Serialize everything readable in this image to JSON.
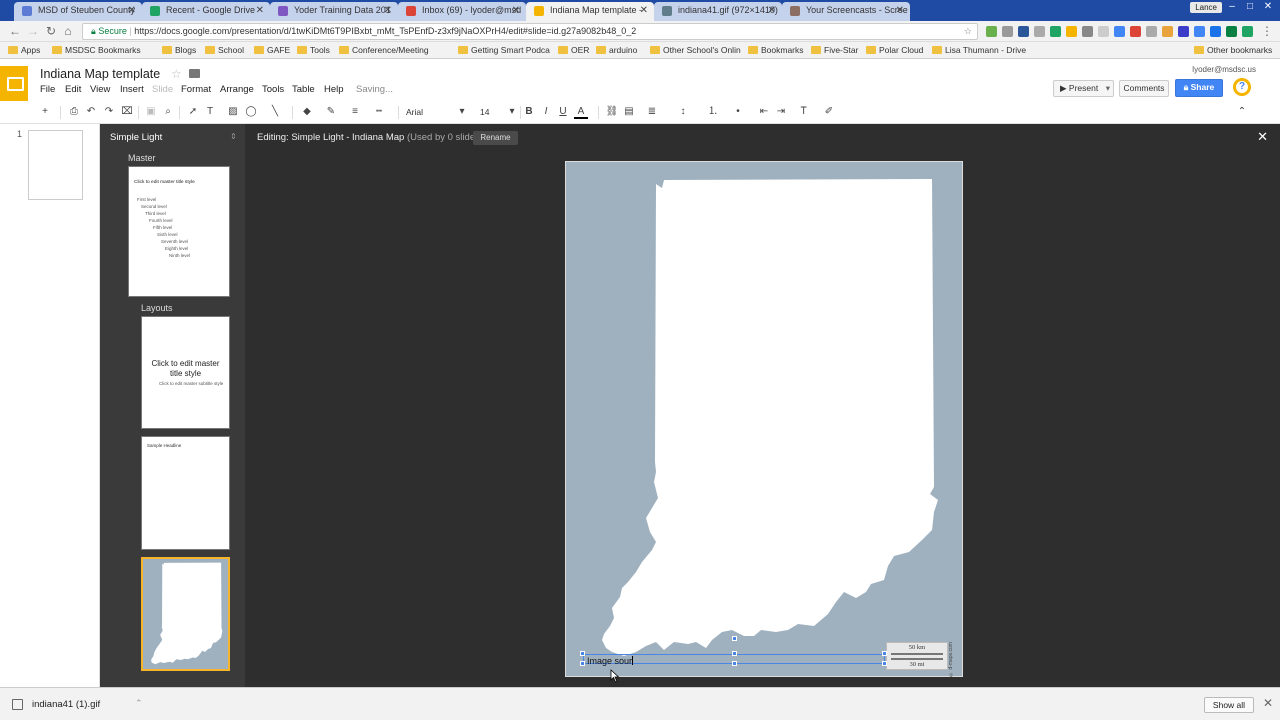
{
  "browser": {
    "tabs": [
      {
        "label": "MSD of Steuben County",
        "color": "#5b7bd5"
      },
      {
        "label": "Recent - Google Drive",
        "color": "#1fa463"
      },
      {
        "label": "Yoder Training Data 201",
        "color": "#7e57c2"
      },
      {
        "label": "Inbox (69) - lyoder@msd",
        "color": "#db4437"
      },
      {
        "label": "Indiana Map template -",
        "color": "#f4b400"
      },
      {
        "label": "indiana41.gif (972×1410)",
        "color": "#607d8b"
      },
      {
        "label": "Your Screencasts - Scree",
        "color": "#8d6e63"
      }
    ],
    "window_user": "Lance",
    "secure_label": "Secure",
    "url": "https://docs.google.com/presentation/d/1twKiDMt6T9PIBxbt_mMt_TsPEnfD-z3xf9jNaOXPrH4/edit#slide=id.g27a9082b48_0_2",
    "bookmarks": [
      "Apps",
      "MSDSC Bookmarks",
      "Blogs",
      "School",
      "GAFE",
      "Tools",
      "Conference/Meeting",
      "Getting Smart Podca",
      "arduino",
      "OER",
      "Other School's Onlin",
      "Bookmarks",
      "Five-Star",
      "Polar Cloud",
      "Lisa Thumann - Drive",
      "Other bookmarks"
    ]
  },
  "docs": {
    "title": "Indiana Map template",
    "menus": [
      "File",
      "Edit",
      "View",
      "Insert",
      "Slide",
      "Format",
      "Arrange",
      "Tools",
      "Table",
      "Help"
    ],
    "saving_status": "Saving...",
    "user_email": "lyoder@msdsc.us",
    "present_label": "Present",
    "comments_label": "Comments",
    "share_label": "Share",
    "help_glyph": "?",
    "font_name": "Arial",
    "font_size": "14"
  },
  "editor": {
    "slide_number": "1",
    "theme_name": "Simple Light",
    "master_label": "Master",
    "layouts_label": "Layouts",
    "master_thumb_title": "Click to edit master title style",
    "master_thumb_bullets": [
      "First level",
      "Second level",
      "Third level",
      "Fourth level",
      "Fifth level",
      "Sixth level",
      "Seventh level",
      "Eighth level",
      "Ninth level"
    ],
    "layout1_title": "Click to edit master title style",
    "layout1_subtitle": "Click to edit master subtitle style",
    "layout2_title": "Sample Headline",
    "editing_prefix": "Editing: Simple Light - Indiana Map",
    "used_by": "(Used by 0 slides)",
    "rename_label": "Rename",
    "close_glyph": "✕",
    "scale_km": "50 km",
    "scale_mi": "30 mi",
    "credit": "© d-maps.com",
    "textbox_value": "Image sour"
  },
  "downloads": {
    "file_name": "indiana41 (1).gif",
    "show_all_label": "Show all"
  },
  "colors": {
    "tab_strip": "#1f4ba4",
    "map_water": "#9fb1bf",
    "selection_blue": "#4a86e8",
    "slides_yellow": "#f4b400"
  }
}
